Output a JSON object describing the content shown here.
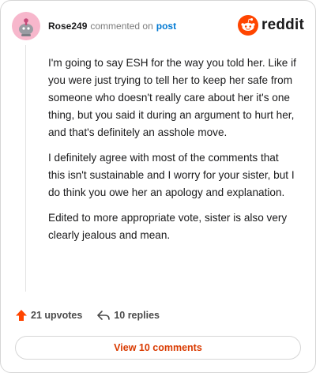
{
  "header": {
    "username": "Rose249",
    "action_text": "commented on",
    "post_link": "post",
    "logo_text": "reddit"
  },
  "comment": {
    "paragraphs": [
      "I'm going to say ESH for the way you told her. Like if you were just trying to tell her to keep her safe from someone who doesn't really care about her it's one thing, but you said it during an argument to hurt her, and that's definitely an asshole move.",
      "I definitely agree with most of the comments that this isn't sustainable and I worry for your sister, but I do think you owe her an apology and explanation.",
      "Edited to more appropriate vote, sister is also very clearly jealous and mean."
    ]
  },
  "actions": {
    "upvotes": "21 upvotes",
    "replies": "10 replies"
  },
  "footer": {
    "view_comments": "View 10 comments"
  },
  "colors": {
    "brand": "#ff4500",
    "link": "#0079d3",
    "button_text": "#d93a00",
    "avatar_bg": "#f7b7cc"
  },
  "icons": {
    "avatar": "snoo-avatar-icon",
    "logo": "reddit-logo-icon",
    "upvote": "upvote-arrow-icon",
    "reply": "reply-arrow-icon"
  }
}
